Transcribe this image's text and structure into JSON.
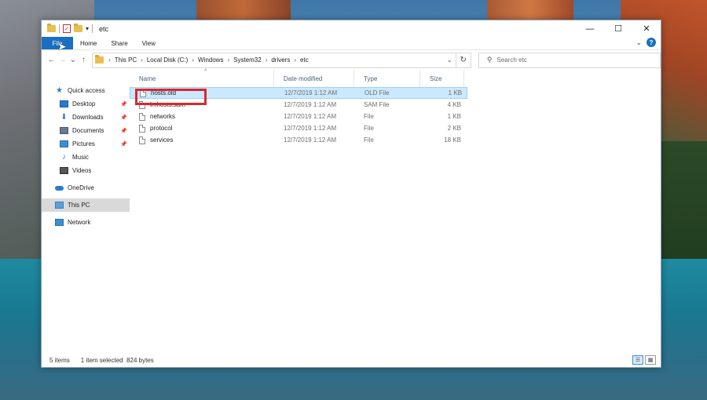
{
  "window": {
    "title": "etc",
    "controls": {
      "minimize": "—",
      "maximize": "☐",
      "close": "✕"
    }
  },
  "ribbon": {
    "tabs": [
      "File",
      "Home",
      "Share",
      "View"
    ],
    "help": "?"
  },
  "nav": {
    "back": "←",
    "forward": "→",
    "recent": "⌄",
    "up": "↑",
    "breadcrumbs": [
      "This PC",
      "Local Disk (C:)",
      "Windows",
      "System32",
      "drivers",
      "etc"
    ],
    "refresh": "↻",
    "search_placeholder": "Search etc"
  },
  "sidebar": {
    "items": [
      {
        "label": "Quick access",
        "icon": "star-icon",
        "pinned": false
      },
      {
        "label": "Desktop",
        "icon": "desktop-icon",
        "pinned": true
      },
      {
        "label": "Downloads",
        "icon": "download-icon",
        "pinned": true
      },
      {
        "label": "Documents",
        "icon": "documents-icon",
        "pinned": true
      },
      {
        "label": "Pictures",
        "icon": "pictures-icon",
        "pinned": true
      },
      {
        "label": "Music",
        "icon": "music-icon",
        "pinned": false
      },
      {
        "label": "Videos",
        "icon": "videos-icon",
        "pinned": false
      },
      {
        "label": "OneDrive",
        "icon": "cloud-icon",
        "pinned": false
      },
      {
        "label": "This PC",
        "icon": "computer-icon",
        "pinned": false,
        "selected": true
      },
      {
        "label": "Network",
        "icon": "network-icon",
        "pinned": false
      }
    ]
  },
  "columns": {
    "name": "Name",
    "date": "Date modified",
    "type": "Type",
    "size": "Size"
  },
  "files": [
    {
      "name": "hosts.old",
      "date": "12/7/2019 1:12 AM",
      "type": "OLD File",
      "size": "1 KB",
      "selected": true
    },
    {
      "name": "lmhosts.sam",
      "date": "12/7/2019 1:12 AM",
      "type": "SAM File",
      "size": "4 KB"
    },
    {
      "name": "networks",
      "date": "12/7/2019 1:12 AM",
      "type": "File",
      "size": "1 KB"
    },
    {
      "name": "protocol",
      "date": "12/7/2019 1:12 AM",
      "type": "File",
      "size": "2 KB"
    },
    {
      "name": "services",
      "date": "12/7/2019 1:12 AM",
      "type": "File",
      "size": "18 KB"
    }
  ],
  "status": {
    "count": "5 items",
    "selection": "1 item selected  824 bytes"
  },
  "colors": {
    "accent": "#1a6fc2",
    "selection": "#cce8ff",
    "highlight": "#d9282f"
  }
}
